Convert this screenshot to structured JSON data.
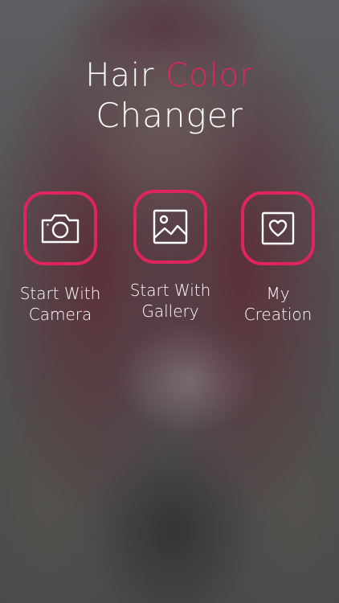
{
  "title": {
    "word1": "Hair",
    "word2": "Color",
    "line2": "Changer"
  },
  "actions": [
    {
      "id": "camera",
      "icon": "camera-icon",
      "label_line1": "Start With",
      "label_line2": "Camera"
    },
    {
      "id": "gallery",
      "icon": "image-icon",
      "label_line1": "Start With",
      "label_line2": "Gallery"
    },
    {
      "id": "creation",
      "icon": "heart-frame-icon",
      "label_line1": "My",
      "label_line2": "Creation"
    }
  ],
  "colors": {
    "accent": "#e0245e",
    "text": "#ffffff"
  }
}
